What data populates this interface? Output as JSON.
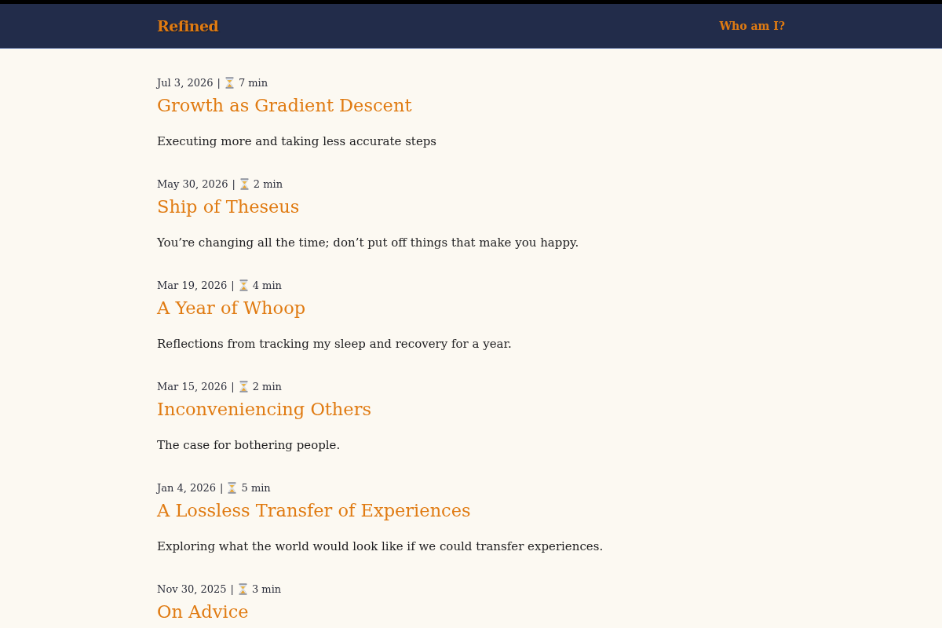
{
  "header": {
    "logo": "Refined",
    "nav_link": "Who am I?"
  },
  "posts": [
    {
      "date": "Jul 3, 2026",
      "separator": "|",
      "read_time": "7 min",
      "title": "Growth as Gradient Descent",
      "summary": "Executing more and taking less accurate steps"
    },
    {
      "date": "May 30, 2026",
      "separator": "|",
      "read_time": "2 min",
      "title": "Ship of Theseus",
      "summary": "You’re changing all the time; don’t put off things that make you happy."
    },
    {
      "date": "Mar 19, 2026",
      "separator": "|",
      "read_time": "4 min",
      "title": "A Year of Whoop",
      "summary": "Reflections from tracking my sleep and recovery for a year."
    },
    {
      "date": "Mar 15, 2026",
      "separator": "|",
      "read_time": "2 min",
      "title": "Inconveniencing Others",
      "summary": "The case for bothering people."
    },
    {
      "date": "Jan 4, 2026",
      "separator": "|",
      "read_time": "5 min",
      "title": "A Lossless Transfer of Experiences",
      "summary": "Exploring what the world would look like if we could transfer experiences."
    },
    {
      "date": "Nov 30, 2025",
      "separator": "|",
      "read_time": "3 min",
      "title": "On Advice"
    }
  ]
}
